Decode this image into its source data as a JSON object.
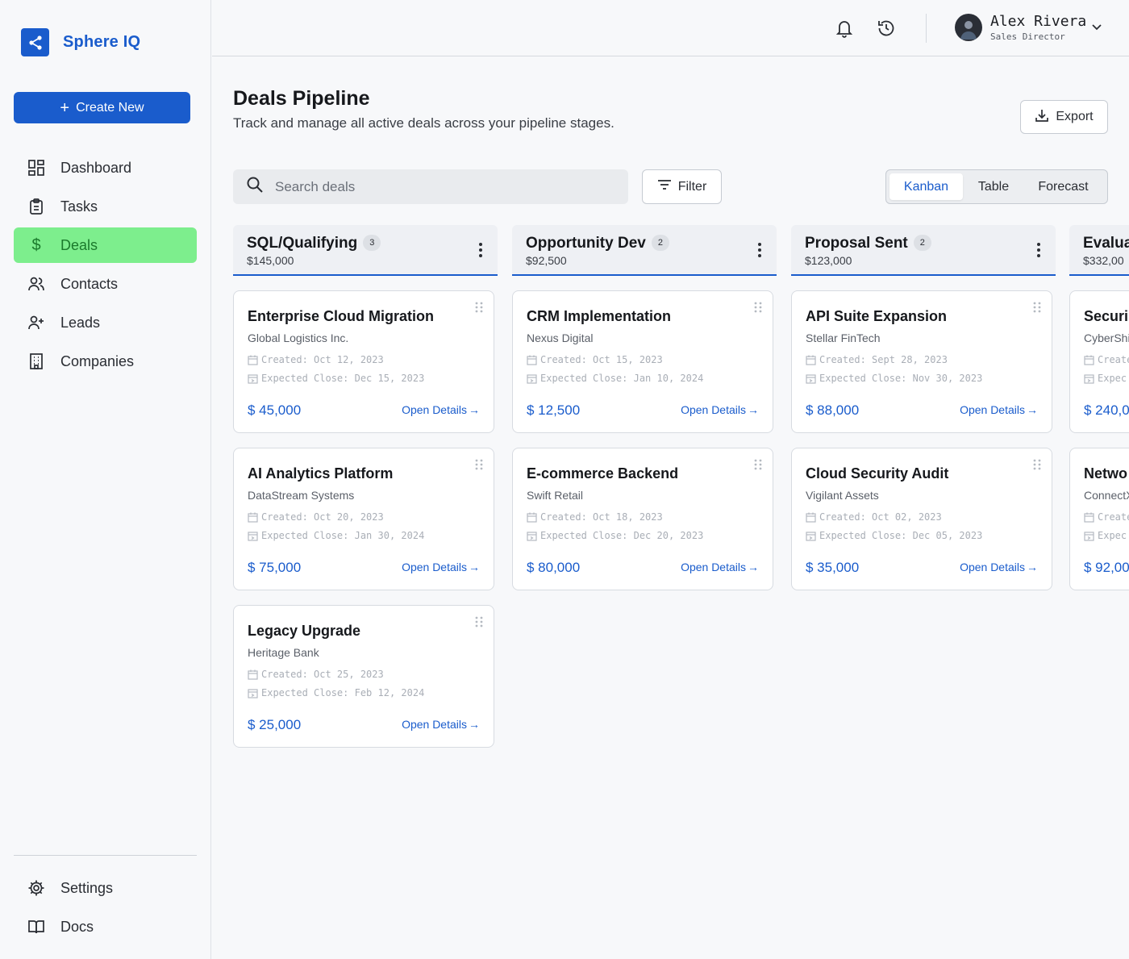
{
  "app": {
    "name": "Sphere IQ"
  },
  "sidebar": {
    "create_label": "Create New",
    "items": [
      {
        "label": "Dashboard",
        "icon": "dashboard-icon",
        "active": false
      },
      {
        "label": "Tasks",
        "icon": "clipboard-icon",
        "active": false
      },
      {
        "label": "Deals",
        "icon": "dollar-icon",
        "active": true
      },
      {
        "label": "Contacts",
        "icon": "users-icon",
        "active": false
      },
      {
        "label": "Leads",
        "icon": "user-plus-icon",
        "active": false
      },
      {
        "label": "Companies",
        "icon": "building-icon",
        "active": false
      }
    ],
    "bottom_items": [
      {
        "label": "Settings",
        "icon": "gear-icon"
      },
      {
        "label": "Docs",
        "icon": "book-icon"
      }
    ]
  },
  "header": {
    "user_name": "Alex Rivera",
    "user_role": "Sales Director"
  },
  "page": {
    "title": "Deals Pipeline",
    "subtitle": "Track and manage all active deals across your pipeline stages.",
    "export_label": "Export",
    "search_placeholder": "Search deals",
    "filter_label": "Filter",
    "views": [
      "Kanban",
      "Table",
      "Forecast"
    ],
    "active_view": "Kanban"
  },
  "colors": {
    "accent": "#1a5ccc",
    "active_nav_bg": "#7dee8d",
    "active_nav_text": "#1b7a2c"
  },
  "columns": [
    {
      "title": "SQL/Qualifying",
      "count": "3",
      "total": "$145,000",
      "cards": [
        {
          "title": "Enterprise Cloud Migration",
          "company": "Global Logistics Inc.",
          "created": "Created: Oct 12, 2023",
          "close": "Expected Close: Dec 15, 2023",
          "value": "$ 45,000",
          "link": "Open Details"
        },
        {
          "title": "AI Analytics Platform",
          "company": "DataStream Systems",
          "created": "Created: Oct 20, 2023",
          "close": "Expected Close: Jan 30, 2024",
          "value": "$ 75,000",
          "link": "Open Details"
        },
        {
          "title": "Legacy Upgrade",
          "company": "Heritage Bank",
          "created": "Created: Oct 25, 2023",
          "close": "Expected Close: Feb 12, 2024",
          "value": "$ 25,000",
          "link": "Open Details"
        }
      ]
    },
    {
      "title": "Opportunity Dev",
      "count": "2",
      "total": "$92,500",
      "cards": [
        {
          "title": "CRM Implementation",
          "company": "Nexus Digital",
          "created": "Created: Oct 15, 2023",
          "close": "Expected Close: Jan 10, 2024",
          "value": "$ 12,500",
          "link": "Open Details"
        },
        {
          "title": "E-commerce Backend",
          "company": "Swift Retail",
          "created": "Created: Oct 18, 2023",
          "close": "Expected Close: Dec 20, 2023",
          "value": "$ 80,000",
          "link": "Open Details"
        }
      ]
    },
    {
      "title": "Proposal Sent",
      "count": "2",
      "total": "$123,000",
      "cards": [
        {
          "title": "API Suite Expansion",
          "company": "Stellar FinTech",
          "created": "Created: Sept 28, 2023",
          "close": "Expected Close: Nov 30, 2023",
          "value": "$ 88,000",
          "link": "Open Details"
        },
        {
          "title": "Cloud Security Audit",
          "company": "Vigilant Assets",
          "created": "Created: Oct 02, 2023",
          "close": "Expected Close: Dec 05, 2023",
          "value": "$ 35,000",
          "link": "Open Details"
        }
      ]
    },
    {
      "title": "Evalua",
      "count": "",
      "total": "$332,00",
      "cards": [
        {
          "title": "Securi",
          "company": "CyberShi",
          "created": "Create",
          "close": "Expec",
          "value": "$ 240,0",
          "link": ""
        },
        {
          "title": "Netwo",
          "company": "ConnectX",
          "created": "Create",
          "close": "Expec",
          "value": "$ 92,00",
          "link": ""
        }
      ]
    }
  ]
}
